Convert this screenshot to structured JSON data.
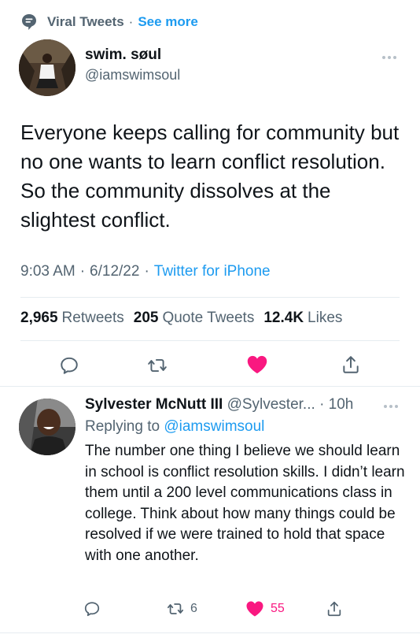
{
  "context": {
    "label": "Viral Tweets",
    "separator": "·",
    "see_more": "See more",
    "icon": "speech-bubble-icon"
  },
  "tweet": {
    "author_name": "swim. søul",
    "author_handle": "@iamswimsoul",
    "text": "Everyone keeps calling for community but no one wants to learn conflict resolution. So the community dissolves at the slightest conflict.",
    "time": "9:03 AM",
    "date": "6/12/22",
    "separator": "·",
    "source": "Twitter for iPhone",
    "stats": {
      "retweets_count": "2,965",
      "retweets_label": "Retweets",
      "quotes_count": "205",
      "quotes_label": "Quote Tweets",
      "likes_count": "12.4K",
      "likes_label": "Likes"
    },
    "liked": true
  },
  "reply": {
    "author_name": "Sylvester McNutt III",
    "author_handle": "@Sylvester...",
    "separator": "·",
    "time": "10h",
    "replying_prefix": "Replying to",
    "replying_to": "@iamswimsoul",
    "text": "The number one thing I believe we should learn in school is conflict resolution skills. I didn’t learn them until a 200 level communications class in college. Think about how many things could be resolved if we were trained to hold that space with one another.",
    "retweet_count": "6",
    "like_count": "55",
    "liked": true
  },
  "colors": {
    "accent": "#1d9bf0",
    "like": "#f91880",
    "secondary_text": "#536471",
    "divider": "#e6ecf0"
  }
}
